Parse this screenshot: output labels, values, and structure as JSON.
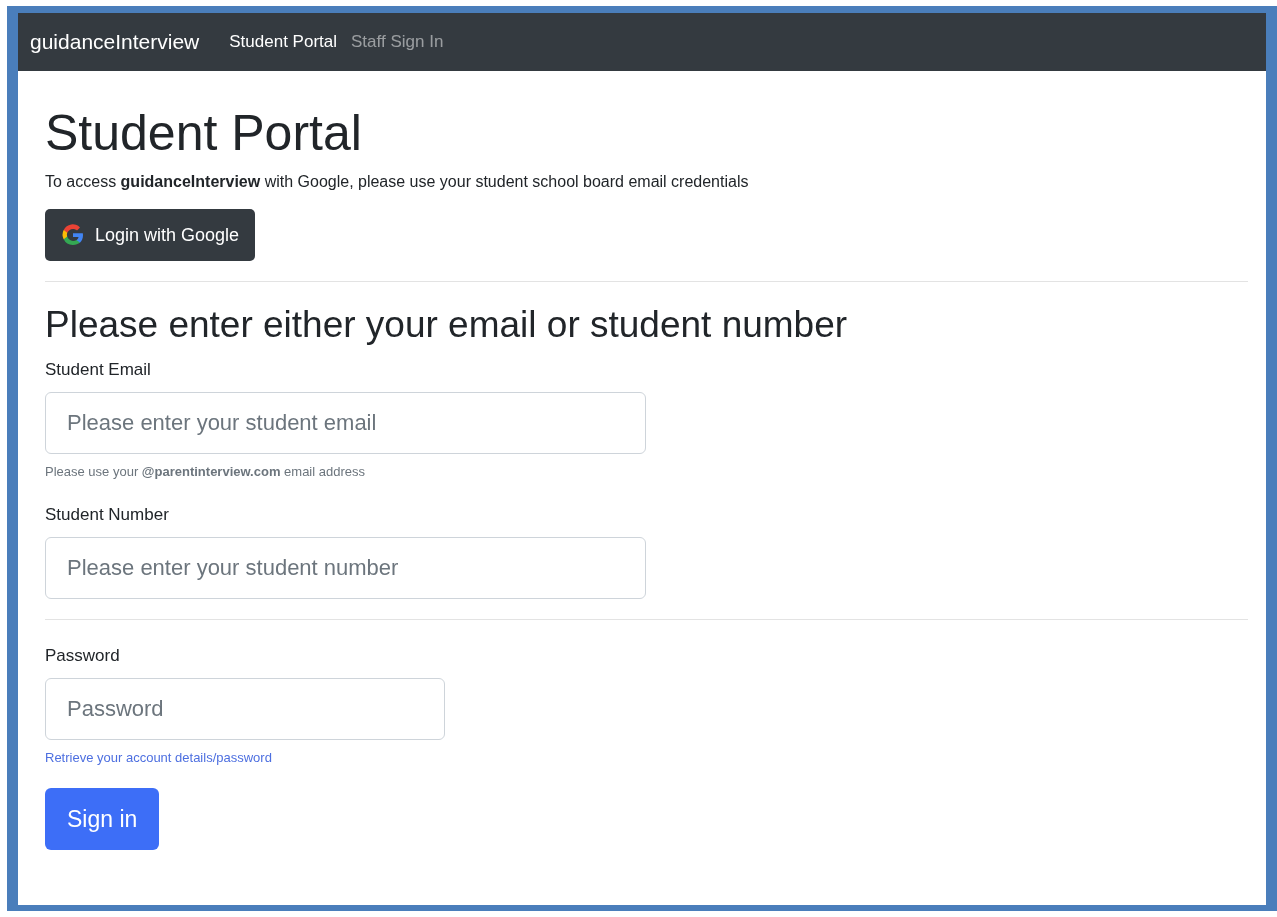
{
  "navbar": {
    "brand": "guidanceInterview",
    "links": [
      {
        "label": "Student Portal",
        "selected": true
      },
      {
        "label": "Staff Sign In",
        "selected": false
      }
    ]
  },
  "heading": "Student Portal",
  "intro": "To access **guidanceInterview** with Google, please use your student school board email credentials",
  "google_button": "Login with Google",
  "form_heading": "Please enter either your email or student number",
  "email": {
    "label": "Student Email",
    "placeholder": "Please enter your student email",
    "help": "Please use your **@parentinterview.com** email address"
  },
  "student_number": {
    "label": "Student Number",
    "placeholder": "Please enter your student number"
  },
  "password": {
    "label": "Password",
    "placeholder": "Password"
  },
  "retrieve_link": "Retrieve your account details/password",
  "submit_button": "Sign in"
}
